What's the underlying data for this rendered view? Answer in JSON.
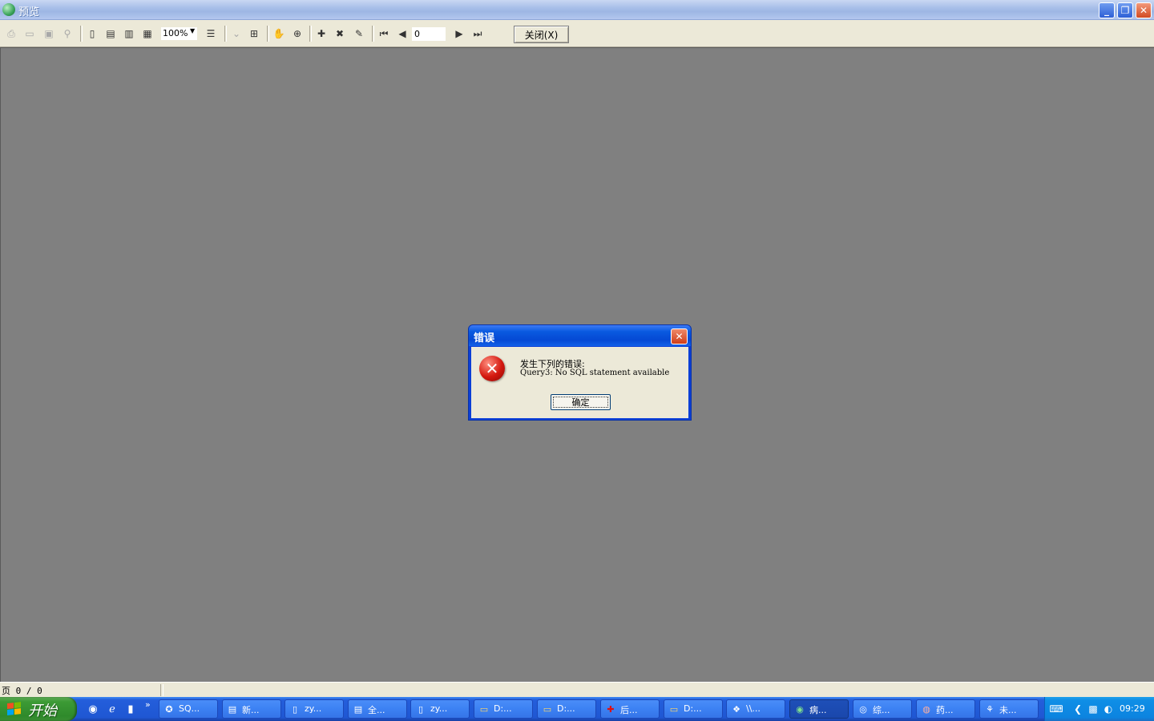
{
  "window": {
    "title": "预览",
    "minimize_glyph": "_",
    "maximize_glyph": "❐",
    "close_glyph": "✕"
  },
  "toolbar": {
    "zoom_value": "100%",
    "page_value": "0",
    "close_label": "关闭(X)",
    "icons": [
      "print-icon",
      "open-icon",
      "save-icon",
      "find-icon",
      "one-page-icon",
      "page-width-icon",
      "two-pages-icon",
      "four-pages-icon",
      "zoom-dropdown",
      "outline-icon",
      "collapse-icon",
      "tree-icon",
      "hand-icon",
      "zoom-in-icon",
      "add-page-icon",
      "delete-page-icon",
      "edit-page-icon",
      "first-page-icon",
      "prev-page-icon",
      "next-page-icon",
      "last-page-icon"
    ]
  },
  "dialog": {
    "title": "错误",
    "heading": "发生下列的错误:",
    "detail": "Query3: No SQL statement available",
    "ok_label": "确定",
    "close_glyph": "✕",
    "icon_glyph": "✕"
  },
  "statusbar": {
    "page_text": "页 0 / 0"
  },
  "taskbar": {
    "start_label": "开始",
    "more_glyph": "»",
    "tasks": [
      {
        "label": "SQ..."
      },
      {
        "label": "新..."
      },
      {
        "label": "zy..."
      },
      {
        "label": "全..."
      },
      {
        "label": "zy..."
      },
      {
        "label": "D:..."
      },
      {
        "label": "D:..."
      },
      {
        "label": "后..."
      },
      {
        "label": "D:..."
      },
      {
        "label": "\\\\..."
      },
      {
        "label": "病..."
      },
      {
        "label": "综..."
      },
      {
        "label": "药..."
      },
      {
        "label": "未..."
      }
    ],
    "clock": "09:29"
  },
  "colors": {
    "workspace": "#808080",
    "taskbar_blue": "#245edb",
    "start_green": "#3c9a35",
    "error_red": "#d4180f"
  }
}
